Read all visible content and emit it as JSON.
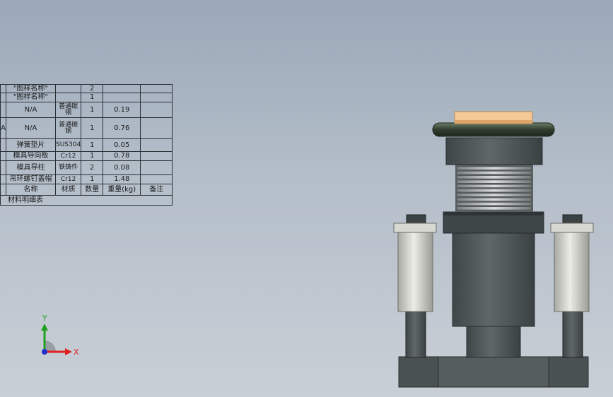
{
  "bom": {
    "rows": [
      {
        "index": "",
        "name": "\"图样名称\"",
        "material": "",
        "qty": "2",
        "weight": "",
        "note": ""
      },
      {
        "index": "",
        "name": "\"图样名称\"",
        "material": "",
        "qty": "1",
        "weight": "",
        "note": ""
      },
      {
        "index": "",
        "name": "N/A",
        "material": "普通碳钢",
        "qty": "1",
        "weight": "0.19",
        "note": ""
      },
      {
        "index": "A",
        "name": "N/A",
        "material": "普通碳钢",
        "qty": "1",
        "weight": "0.76",
        "note": ""
      },
      {
        "index": "",
        "name": "弹簧垫片",
        "material": "SUS304",
        "qty": "1",
        "weight": "0.05",
        "note": ""
      },
      {
        "index": "",
        "name": "模具导向板",
        "material": "Cr12",
        "qty": "1",
        "weight": "0.78",
        "note": ""
      },
      {
        "index": "",
        "name": "模具导柱",
        "material": "铁铸件",
        "qty": "2",
        "weight": "0.08",
        "note": ""
      },
      {
        "index": "",
        "name": "吊环螺钉盖帽",
        "material": "Cr12",
        "qty": "1",
        "weight": "1.48",
        "note": ""
      }
    ],
    "header": {
      "name": "名称",
      "material": "材质",
      "qty": "数量",
      "weight": "重量(kg)",
      "note": "备注"
    },
    "caption": "材料明细表"
  },
  "triad": {
    "x_label": "X",
    "y_label": "Y",
    "x_color": "#e02020",
    "y_color": "#20a020",
    "z_color": "#2030d0"
  },
  "colors": {
    "part_dark": "#4a5152",
    "part_mid": "#5d6566",
    "part_light": "#d7d7d2",
    "handle_green": "#3a4a38",
    "cap_orange": "#f2c08a"
  }
}
